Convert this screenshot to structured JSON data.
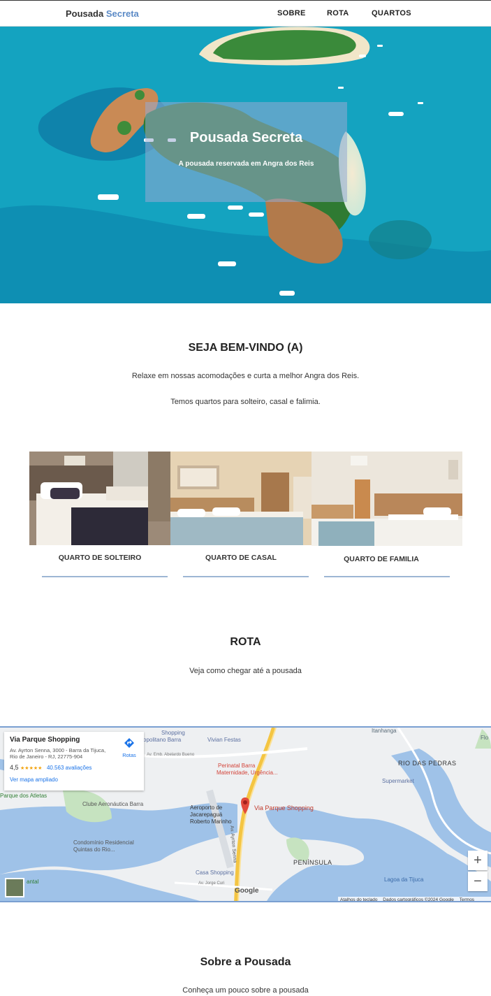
{
  "nav": {
    "brand_part1": "Pousada",
    "brand_part2": "Secreta",
    "links": [
      "SOBRE",
      "ROTA",
      "QUARTOS"
    ]
  },
  "hero": {
    "title": "Pousada Secreta",
    "subtitle": "A pousada reservada em Angra dos Reis"
  },
  "welcome": {
    "heading": "SEJA BEM-VINDO (A)",
    "line1": "Relaxe em nossas acomodações e curta a melhor Angra dos Reis.",
    "line2": "Temos quartos para solteiro, casal e falimia."
  },
  "rooms": [
    {
      "label": "QUARTO DE SOLTEIRO"
    },
    {
      "label": "QUARTO DE CASAL"
    },
    {
      "label": "QUARTO DE FAMILIA"
    }
  ],
  "route": {
    "heading": "ROTA",
    "text": "Veja como chegar até a pousada"
  },
  "map": {
    "place_name": "Via Parque Shopping",
    "address": "Av. Ayrton Senna, 3000 - Barra da Tijuca, Rio de Janeiro - RJ, 22775-904",
    "rating": "4,5",
    "stars": "★★★★★",
    "reviews": "40.563 avaliações",
    "directions": "Rotas",
    "view_larger": "Ver mapa ampliado",
    "marker_label": "Via Parque Shopping",
    "labels": {
      "shopping": "Shopping",
      "metropolitano": "opolitano Barra",
      "vivian": "Vivian Festas",
      "itanhanga": "Itanhanga",
      "flo": "Flo",
      "rio_das_pedras": "RIO DAS PEDRAS",
      "perinatal": "Perinatal Barra",
      "maternidade": "Maternidade, Urgência...",
      "supermarket": "Supermarket",
      "atletas": "Parque dos Atletas",
      "clube": "Clube Aeronáutica Barra",
      "aeroporto": "Aeroporto de Jacarepaguá Roberto Marinho",
      "condominio": "Condomínio Residencial Quintas do Rio...",
      "peninsula": "PENÍNSULA",
      "lagoa": "Lagoa da Tijuca",
      "casa_shopping": "Casa Shopping",
      "avenida": "Av. Ayrton Senna",
      "estrada": "Av. Emb. Abelardo Bueno",
      "jorge": "Av. Jorge Curi",
      "atalhos": "Atalhos do teclado",
      "dados": "Dados cartográficos ©2024 Google",
      "termos": "Termos",
      "google": "Google",
      "antal": "antal"
    }
  },
  "about": {
    "heading": "Sobre a Pousada",
    "text": "Conheça um pouco sobre a pousada"
  },
  "colors": {
    "accent": "#5b8ac6",
    "room_line": "#9db6d4",
    "map_border": "#7a9fd1"
  }
}
